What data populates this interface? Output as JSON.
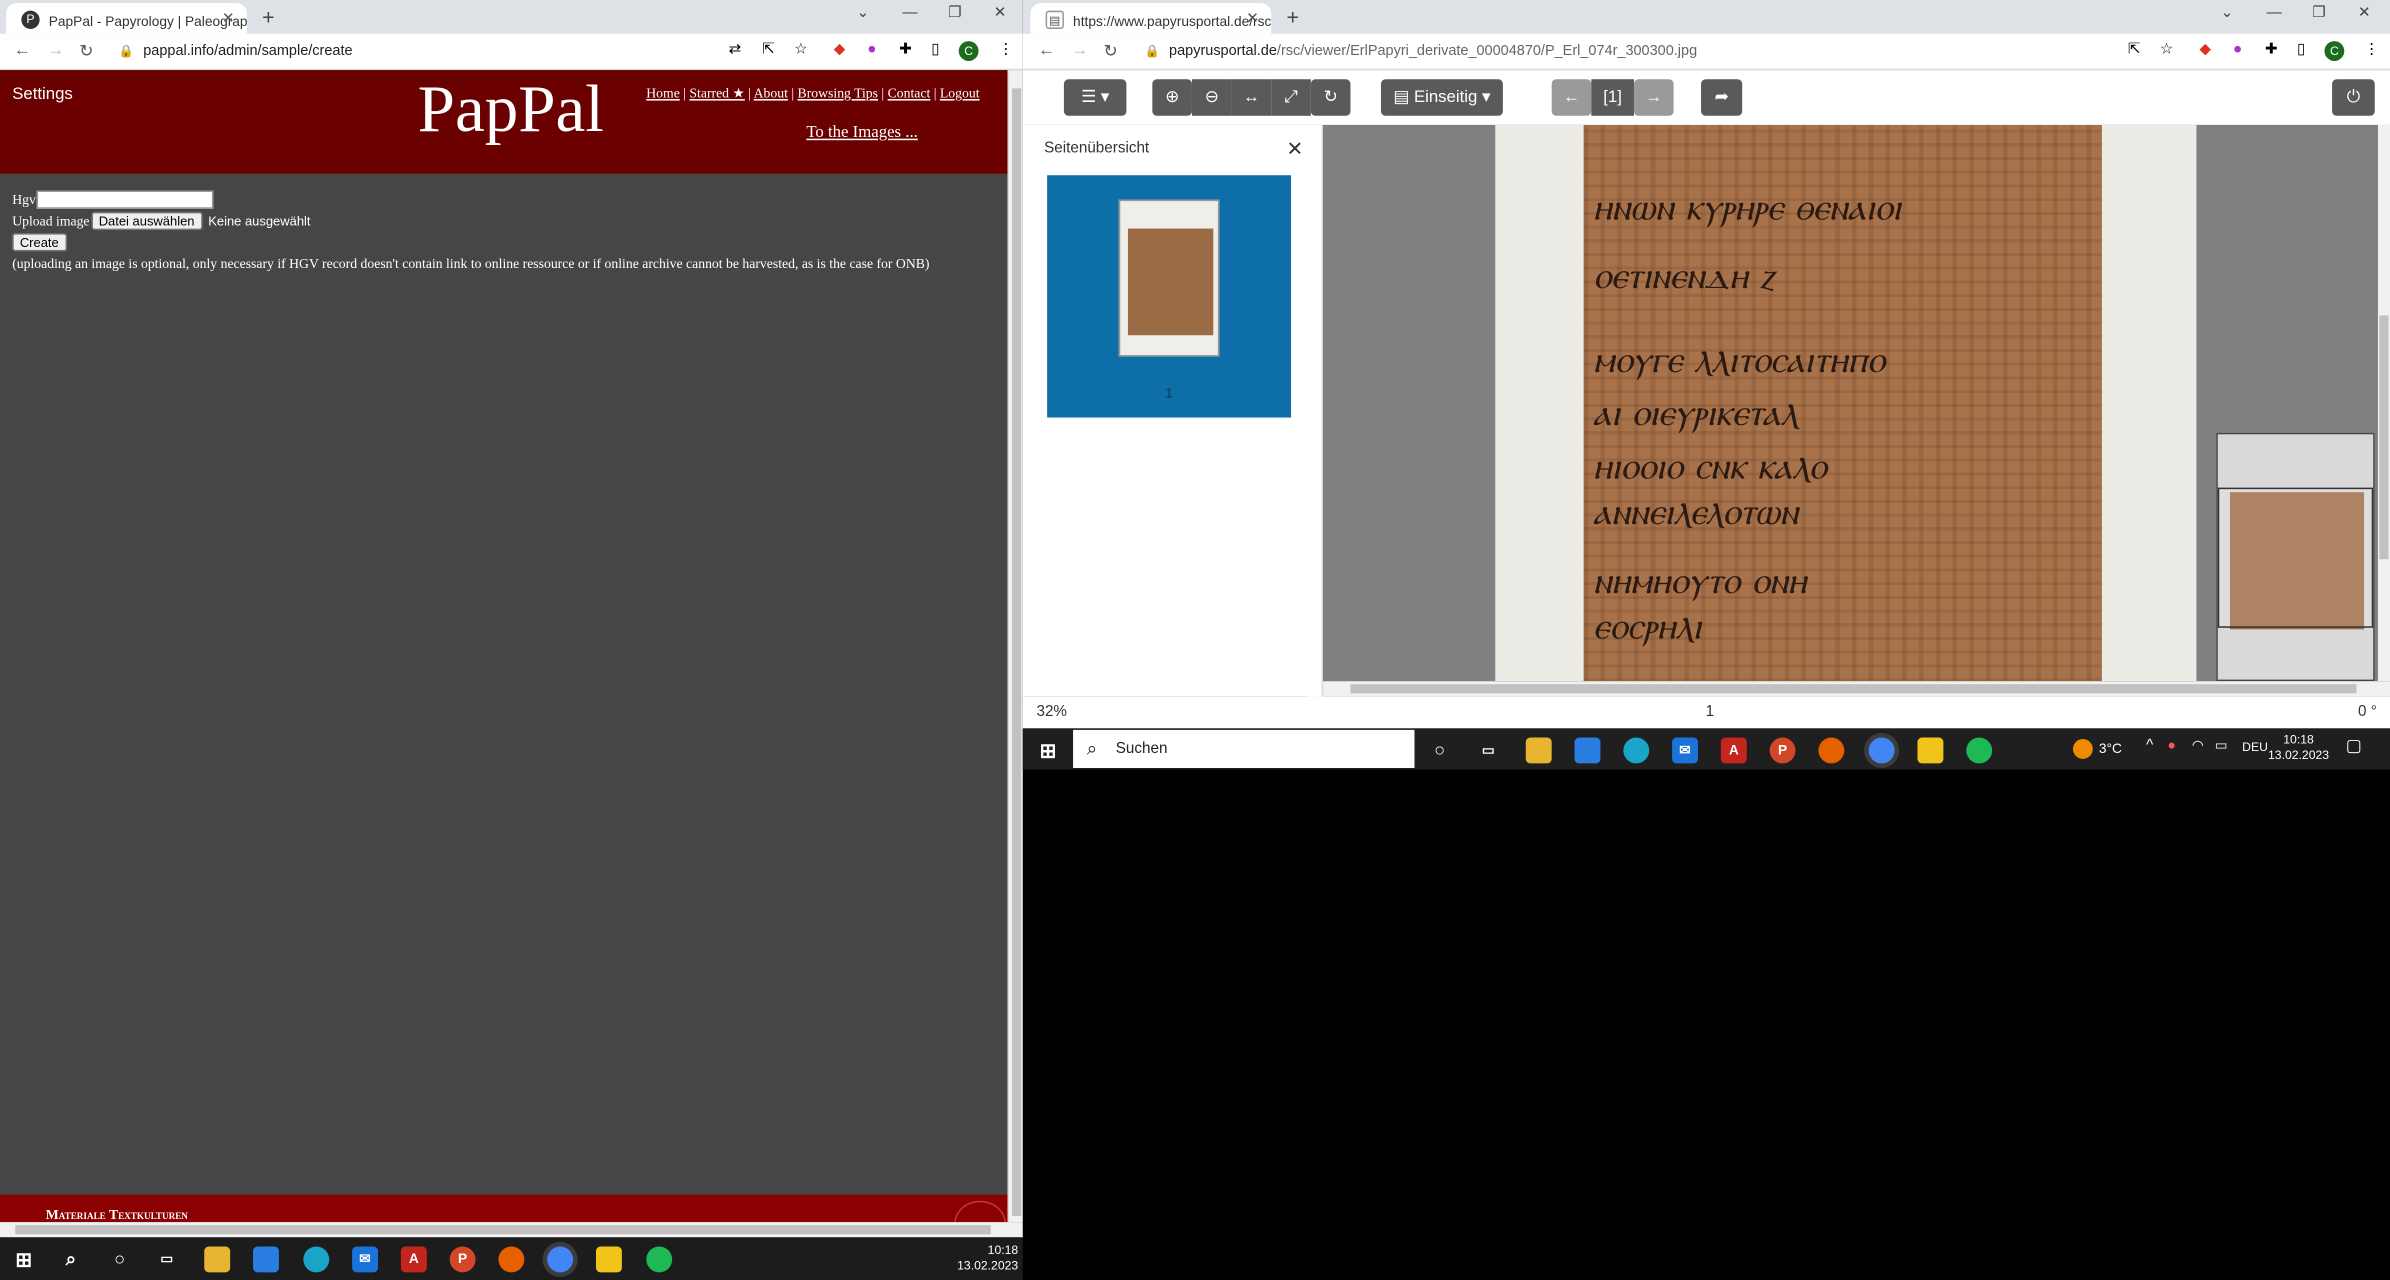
{
  "left_browser": {
    "tab_title": "PapPal - Papyrology | Paleograph",
    "tab_favicon": "pappal-favicon-icon",
    "url": "pappal.info/admin/sample/create"
  },
  "right_browser": {
    "tab_title": "https://www.papyrusportal.de/rsc",
    "url_domain": "papyrusportal.de",
    "url_path": "/rsc/viewer/ErlPapyri_derivate_00004870/P_Erl_074r_300300.jpg"
  },
  "avatar_letter": "C",
  "pappal": {
    "settings_label": "Settings",
    "logo": "PapPal",
    "nav": [
      "Home",
      "Starred ★",
      "About",
      "Browsing Tips",
      "Contact",
      "Logout"
    ],
    "to_images": "To the Images ...",
    "hgv_label": "Hgv",
    "hgv_value": "",
    "upload_label": "Upload image",
    "choose_file_button": "Datei auswählen",
    "no_file_text": "Keine ausgewählt",
    "create_button": "Create",
    "note": "(uploading an image is optional, only necessary if HGV record doesn't contain link to online ressource or if online archive cannot be harvested, as is the case for ONB)",
    "footer_text": "Materiale Textkulturen"
  },
  "viewer": {
    "layout_select": "Einseitig",
    "page_indicator": "[1]",
    "sidebar_title": "Seitenübersicht",
    "thumb_label": "1",
    "zoom": "32%",
    "page": "1",
    "rotation": "0 °",
    "greek_lines": [
      "ⲏⲛⲱⲛ ⲕⲩⲣⲏⲣⲉ ⲑⲉⲛⲁⲓⲟⲓ",
      "ⲟⲉⲧⲓⲛⲉⲛⲇⲏ ⲍ",
      "ⲙⲟⲩⲅⲉ ⲗⲗⲓⲧⲟⲥⲁⲓⲧⲏⲡⲟ",
      "ⲁⲓ ⲟⲓⲉⲩⲣⲓⲕⲉⲧⲁⲗ",
      "ⲏⲓⲟⲟⲓⲟ ⲥⲛⲕ ⲕⲁⲗⲟ",
      "ⲁⲛⲛⲉⲓⲗⲉⲗⲟⲧⲱⲛ",
      "ⲛⲏⲙⲏⲟⲩⲧⲟ ⲟⲛⲏ",
      "ⲉⲟⲥⲣⲏⲗⲓ"
    ]
  },
  "taskbar_left": {
    "time": "10:18",
    "date": "13.02.2023"
  },
  "taskbar_right": {
    "search_placeholder": "Suchen",
    "weather": "3°C",
    "language": "DEU",
    "time": "10:18",
    "date": "13.02.2023"
  },
  "colors": {
    "pappal_header": "#6b0000",
    "pappal_body": "#464646",
    "viewer_thumb_card": "#0d6ea8",
    "viewer_button": "#5a5a5a"
  }
}
